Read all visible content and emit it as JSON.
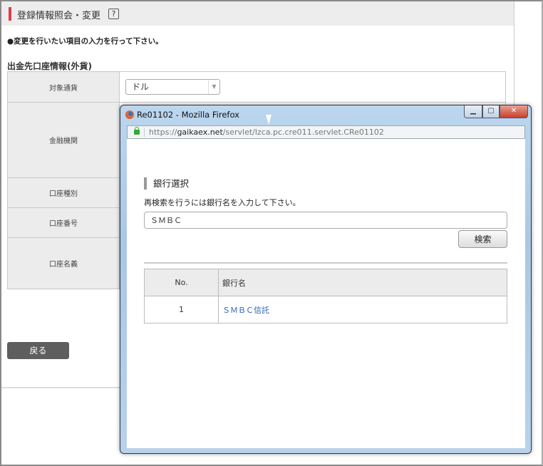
{
  "page": {
    "title": "登録情報照会・変更",
    "help_icon": "?",
    "note": "●変更を行いたい項目の入力を行って下さい。",
    "section_title": "出金先口座情報(外貨)",
    "rows": [
      {
        "label": "対象通貨",
        "value": "ドル"
      },
      {
        "label": "金融機関"
      },
      {
        "label": "口座種別"
      },
      {
        "label": "口座番号"
      },
      {
        "label": "口座名義"
      }
    ],
    "back_label": "戻る",
    "accent": "#e03c50"
  },
  "popup": {
    "window_title": "Re01102 - Mozilla Firefox",
    "url_scheme": "https://",
    "url_domain": "gaikaex.net",
    "url_path": "/servlet/lzca.pc.cre011.servlet.CRe01102",
    "heading": "銀行選択",
    "instruction": "再検索を行うには銀行名を入力して下さい。",
    "search_value": "ＳＭＢＣ",
    "search_button": "検索",
    "table": {
      "headers": [
        "No.",
        "銀行名"
      ],
      "rows": [
        {
          "no": "1",
          "name": "ＳＭＢＣ信託"
        }
      ]
    },
    "link_color": "#2a62b8"
  }
}
